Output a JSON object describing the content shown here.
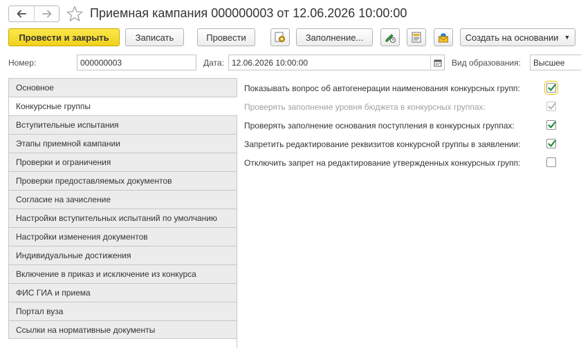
{
  "window": {
    "title": "Приемная кампания 000000003 от 12.06.2026 10:00:00"
  },
  "nav": {
    "back_icon": "arrow-left-icon",
    "forward_icon": "arrow-right-icon",
    "favorite_icon": "star-icon"
  },
  "toolbar": {
    "post_close_label": "Провести и закрыть",
    "save_label": "Записать",
    "post_label": "Провести",
    "fill_label": "Заполнение...",
    "create_based_label": "Создать на основании"
  },
  "fields": {
    "number_label": "Номер:",
    "number_value": "000000003",
    "date_label": "Дата:",
    "date_value": "12.06.2026 10:00:00",
    "edu_label": "Вид образования:",
    "edu_value": "Высшее"
  },
  "tabs": [
    {
      "label": "Основное",
      "active": false
    },
    {
      "label": "Конкурсные группы",
      "active": true
    },
    {
      "label": "Вступительные испытания",
      "active": false
    },
    {
      "label": "Этапы приемной кампании",
      "active": false
    },
    {
      "label": "Проверки и ограничения",
      "active": false
    },
    {
      "label": "Проверки предоставляемых документов",
      "active": false
    },
    {
      "label": "Согласие на зачисление",
      "active": false
    },
    {
      "label": "Настройки вступительных испытаний по умолчанию",
      "active": false
    },
    {
      "label": "Настройки изменения документов",
      "active": false
    },
    {
      "label": "Индивидуальные достижения",
      "active": false
    },
    {
      "label": "Включение в приказ и исключение из конкурса",
      "active": false
    },
    {
      "label": "ФИС ГИА и приема",
      "active": false
    },
    {
      "label": "Портал вуза",
      "active": false
    },
    {
      "label": "Ссылки на нормативные документы",
      "active": false
    }
  ],
  "options": [
    {
      "label": "Показывать вопрос об автогенерации наименования конкурсных групп:",
      "checked": true,
      "disabled": false,
      "focused": true
    },
    {
      "label": "Проверять заполнение уровня бюджета в конкурсных группах:",
      "checked": true,
      "disabled": true,
      "focused": false
    },
    {
      "label": "Проверять заполнение основания поступления в конкурсных группах:",
      "checked": true,
      "disabled": false,
      "focused": false
    },
    {
      "label": "Запретить редактирование реквизитов конкурсной группы в заявлении:",
      "checked": true,
      "disabled": false,
      "focused": false
    },
    {
      "label": "Отключить запрет на редактирование утвержденных конкурсных групп:",
      "checked": false,
      "disabled": false,
      "focused": false
    }
  ],
  "colors": {
    "accent": "#f2d11b",
    "check": "#1f8a3a",
    "check_disabled": "#b5b5b5"
  }
}
